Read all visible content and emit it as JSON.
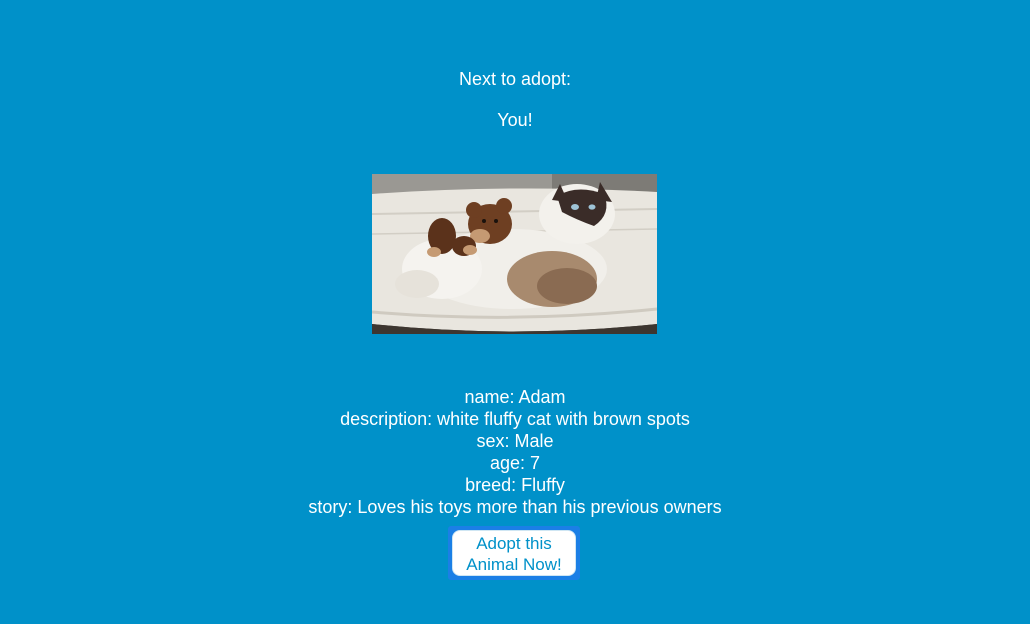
{
  "header": {
    "next_label": "Next to adopt:",
    "you_label": "You!"
  },
  "pet": {
    "image_subject": "cat lying in hammock with teddy bear",
    "details": [
      "name: Adam",
      "description: white fluffy cat with brown spots",
      "sex: Male",
      "age: 7",
      "breed: Fluffy",
      "story: Loves his toys more than his previous owners"
    ]
  },
  "actions": {
    "adopt_line1": "Adopt this",
    "adopt_line2": "Animal Now!"
  },
  "colors": {
    "background": "#0091c9",
    "text": "#ffffff",
    "button_text": "#0091c9",
    "button_outline": "#1b7fe6"
  }
}
